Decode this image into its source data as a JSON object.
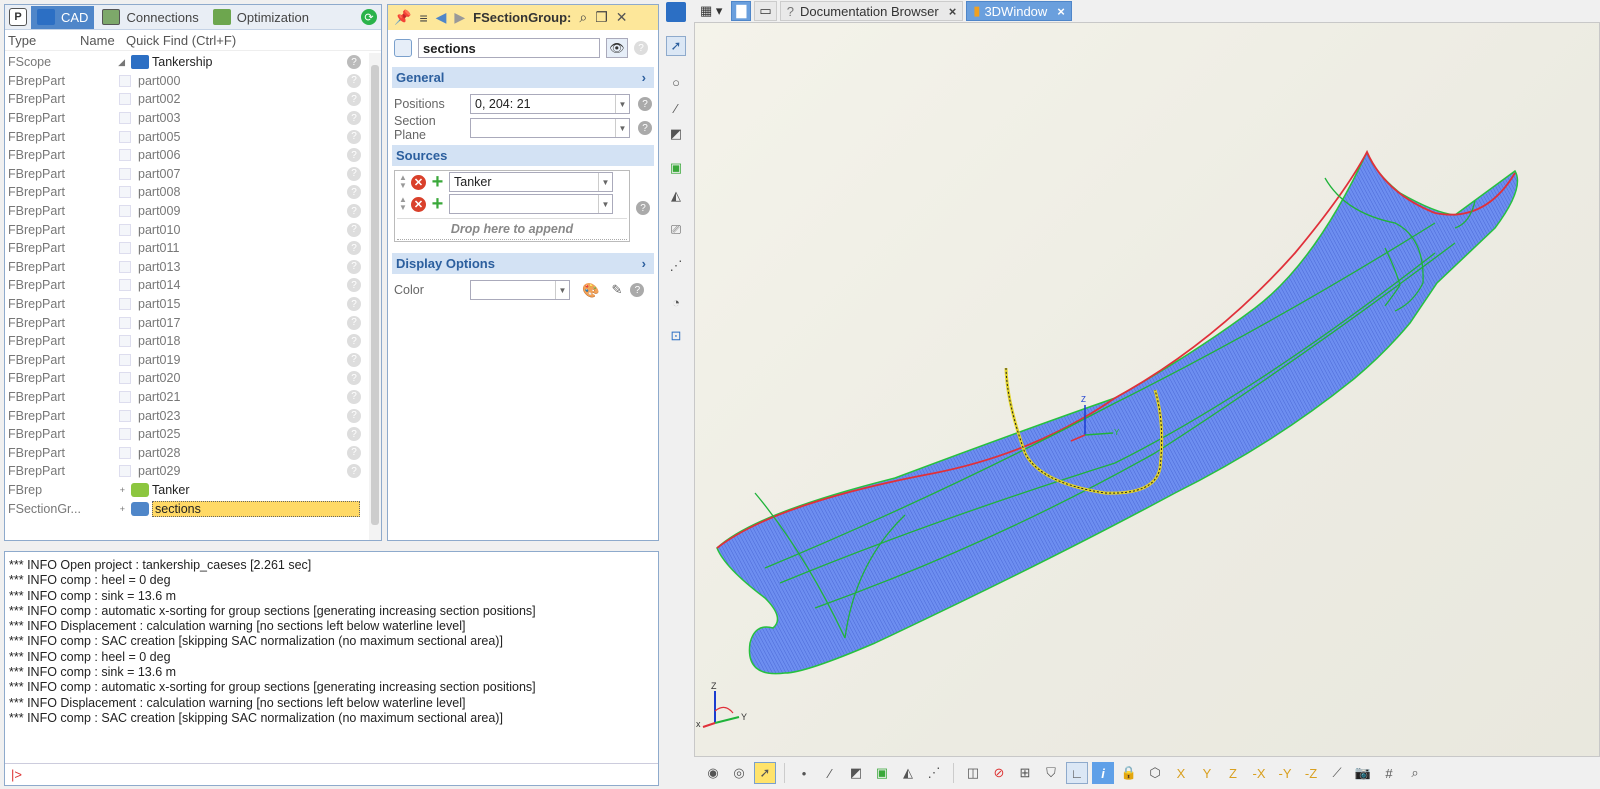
{
  "tree_panel": {
    "tabs": [
      {
        "label": "CAD",
        "active": true
      },
      {
        "label": "Connections",
        "active": false
      },
      {
        "label": "Optimization",
        "active": false
      }
    ],
    "p_label": "P",
    "header": {
      "type": "Type",
      "name": "Name",
      "search_placeholder": "Quick Find (Ctrl+F)"
    },
    "rows": [
      {
        "type": "FScope",
        "name": "Tankership"
      },
      {
        "type": "FBrepPart",
        "name": "part000"
      },
      {
        "type": "FBrepPart",
        "name": "part002"
      },
      {
        "type": "FBrepPart",
        "name": "part003"
      },
      {
        "type": "FBrepPart",
        "name": "part005"
      },
      {
        "type": "FBrepPart",
        "name": "part006"
      },
      {
        "type": "FBrepPart",
        "name": "part007"
      },
      {
        "type": "FBrepPart",
        "name": "part008"
      },
      {
        "type": "FBrepPart",
        "name": "part009"
      },
      {
        "type": "FBrepPart",
        "name": "part010"
      },
      {
        "type": "FBrepPart",
        "name": "part011"
      },
      {
        "type": "FBrepPart",
        "name": "part013"
      },
      {
        "type": "FBrepPart",
        "name": "part014"
      },
      {
        "type": "FBrepPart",
        "name": "part015"
      },
      {
        "type": "FBrepPart",
        "name": "part017"
      },
      {
        "type": "FBrepPart",
        "name": "part018"
      },
      {
        "type": "FBrepPart",
        "name": "part019"
      },
      {
        "type": "FBrepPart",
        "name": "part020"
      },
      {
        "type": "FBrepPart",
        "name": "part021"
      },
      {
        "type": "FBrepPart",
        "name": "part023"
      },
      {
        "type": "FBrepPart",
        "name": "part025"
      },
      {
        "type": "FBrepPart",
        "name": "part028"
      },
      {
        "type": "FBrepPart",
        "name": "part029"
      },
      {
        "type": "FBrep",
        "name": "Tanker"
      },
      {
        "type": "FSectionGr...",
        "name": "sections"
      }
    ]
  },
  "prop_panel": {
    "title": "FSectionGroup:",
    "object_name": "sections",
    "general": {
      "label": "General",
      "positions_label": "Positions",
      "positions_value": "0, 204: 21",
      "section_plane_label": "Section Plane",
      "section_plane_value": ""
    },
    "sources": {
      "label": "Sources",
      "items": [
        "Tanker",
        ""
      ],
      "drop_label": "Drop here to append"
    },
    "display_options": {
      "label": "Display Options",
      "color_label": "Color",
      "color_value": ""
    }
  },
  "console": {
    "lines": [
      "*** INFO Open project : tankership_caeses [2.261 sec]",
      "*** INFO comp : heel = 0 deg",
      "*** INFO comp : sink = 13.6 m",
      "*** INFO comp : automatic x-sorting for group sections [generating increasing section positions]",
      "*** INFO Displacement : calculation warning [no sections left below waterline level]",
      "*** INFO comp : SAC creation [skipping SAC normalization (no maximum sectional area)]",
      "*** INFO comp : heel = 0 deg",
      "*** INFO comp : sink = 13.6 m",
      "*** INFO comp : automatic x-sorting for group sections [generating increasing section positions]",
      "*** INFO Displacement : calculation warning [no sections left below waterline level]",
      "*** INFO comp : SAC creation [skipping SAC normalization (no maximum sectional area)]"
    ],
    "prompt": "|>"
  },
  "right_tabs": [
    {
      "label": "Documentation Browser",
      "active": false
    },
    {
      "label": "3DWindow",
      "active": true
    }
  ],
  "axes": {
    "x": "x",
    "y": "Y",
    "z": "Z"
  },
  "colors": {
    "accent": "#4f86c9",
    "hull": "#5b7fe8",
    "hull_edge": "#e0303a",
    "section_green": "#26c13f",
    "selection": "#ffd966"
  }
}
